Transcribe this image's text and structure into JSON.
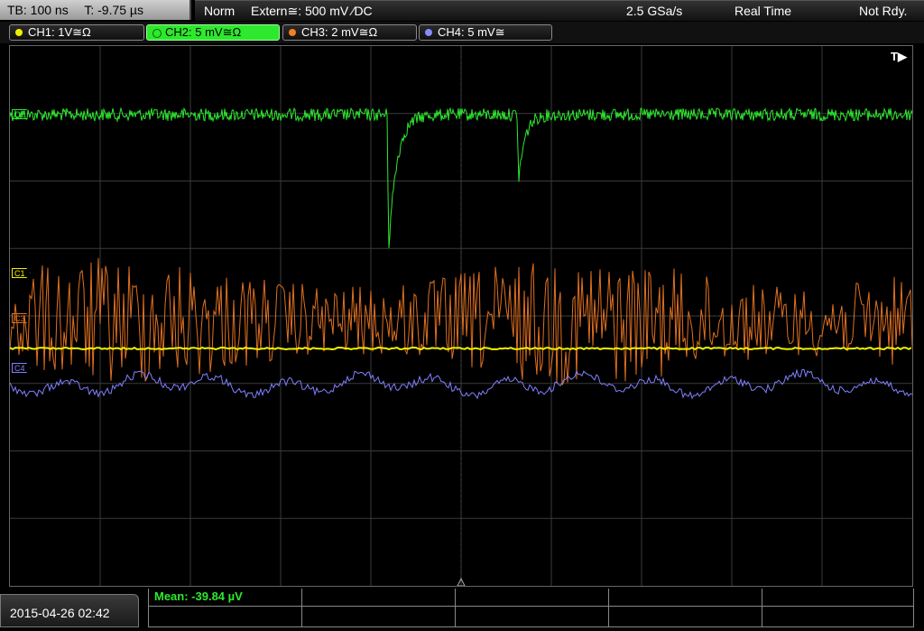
{
  "header": {
    "timebase": "TB: 100 ns",
    "trigger_time": "T: -9.75 µs",
    "mode": "Norm",
    "trigger_source": "Extern≅: 500 mV ⁄DC",
    "sample_rate": "2.5 GSa/s",
    "acquisition": "Real Time",
    "status": "Not Rdy."
  },
  "channels": [
    {
      "label": "CH1: 1V≅Ω",
      "color": "#f2f000"
    },
    {
      "label": "CH2: 5 mV≅Ω",
      "color": "#2ee82e",
      "active": true
    },
    {
      "label": "CH3: 2 mV≅Ω",
      "color": "#f08020"
    },
    {
      "label": "CH4: 5 mV≅",
      "color": "#8a8aff"
    }
  ],
  "markers": {
    "c1": "C1",
    "c2": "C2",
    "c3": "C3",
    "c4": "C4",
    "trigger": "T▶"
  },
  "measurement": {
    "mean": "Mean: -39.84 µV"
  },
  "datetime": "2015-04-26 02:42",
  "colors": {
    "grid": "#3a3a3a",
    "ch1": "#f2f000",
    "ch2": "#2ee82e",
    "ch3": "#e07020",
    "ch4": "#8080ff"
  }
}
